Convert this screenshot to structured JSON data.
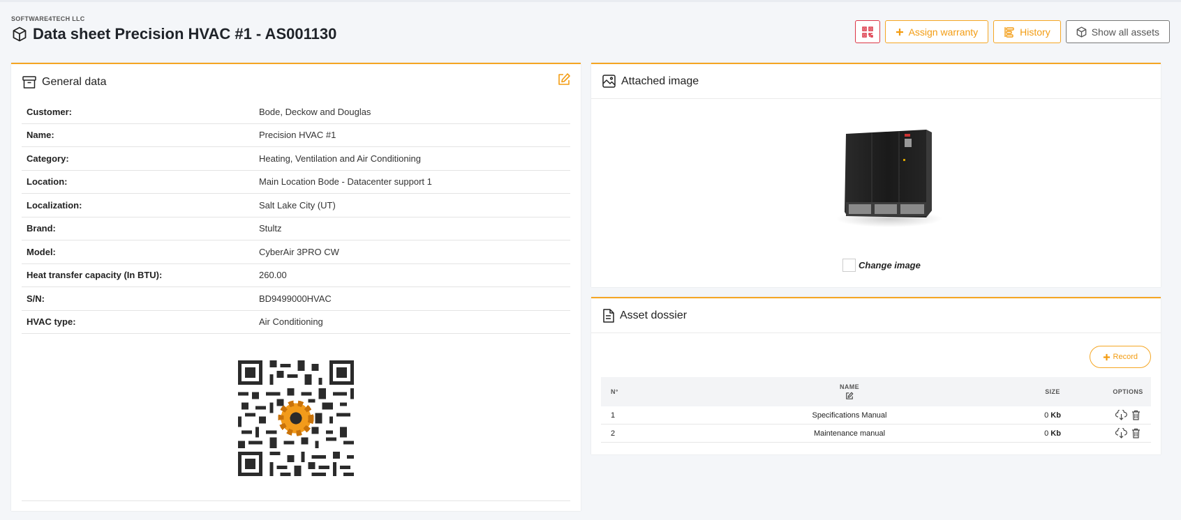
{
  "header": {
    "company": "SOFTWARE4TECH LLC",
    "title": "Data sheet Precision HVAC #1 - AS001130"
  },
  "toolbar": {
    "assign_warranty": "Assign warranty",
    "history": "History",
    "show_all_assets": "Show all assets"
  },
  "general": {
    "title": "General data",
    "rows": [
      {
        "label": "Customer:",
        "value": "Bode, Deckow and Douglas"
      },
      {
        "label": "Name:",
        "value": "Precision HVAC #1"
      },
      {
        "label": "Category:",
        "value": "Heating, Ventilation and Air Conditioning"
      },
      {
        "label": "Location:",
        "value": "Main Location Bode - Datacenter support 1"
      },
      {
        "label": "Localization:",
        "value": "Salt Lake City (UT)"
      },
      {
        "label": "Brand:",
        "value": "Stultz"
      },
      {
        "label": "Model:",
        "value": "CyberAir 3PRO CW"
      },
      {
        "label": "Heat transfer capacity (In BTU):",
        "value": "260.00"
      },
      {
        "label": "S/N:",
        "value": "BD9499000HVAC"
      },
      {
        "label": "HVAC type:",
        "value": "Air Conditioning"
      }
    ]
  },
  "image": {
    "title": "Attached image",
    "change_label": "Change image"
  },
  "dossier": {
    "title": "Asset dossier",
    "record_label": "Record",
    "columns": {
      "num": "N°",
      "name": "NAME",
      "size": "SIZE",
      "options": "OPTIONS"
    },
    "rows": [
      {
        "num": "1",
        "name": "Specifications Manual",
        "size": "0",
        "unit": "Kb"
      },
      {
        "num": "2",
        "name": "Maintenance manual",
        "size": "0",
        "unit": "Kb"
      }
    ]
  },
  "colors": {
    "accent": "#f5a623",
    "danger": "#dc3545",
    "background": "#f4f6f9"
  }
}
